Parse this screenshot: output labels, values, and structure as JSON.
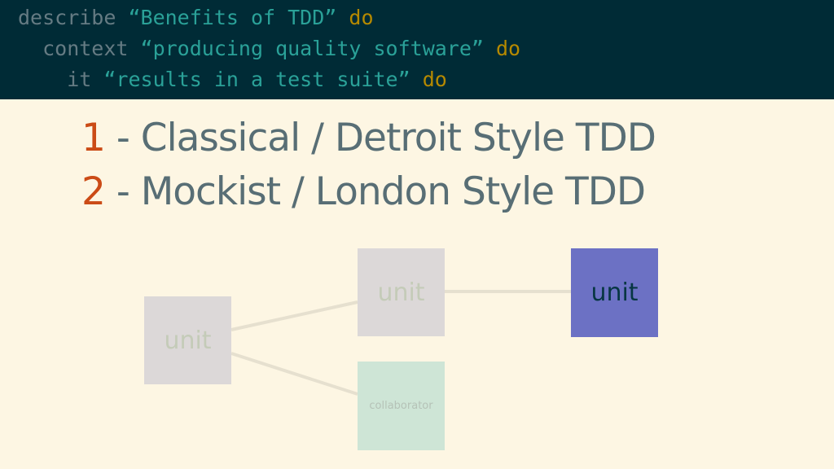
{
  "code": {
    "line1": {
      "keyword": "describe ",
      "string": "“Benefits of TDD”",
      "do": " do"
    },
    "line2": {
      "keyword": "  context ",
      "string": "“producing quality software”",
      "do": " do"
    },
    "line3": {
      "keyword": "    it ",
      "string": "“results in a test suite”",
      "do": " do"
    }
  },
  "headings": [
    {
      "number": "1",
      "text": " - Classical / Detroit Style TDD"
    },
    {
      "number": "2",
      "text": " - Mockist / London Style TDD"
    }
  ],
  "diagram": {
    "nodes": {
      "unit_left": "unit",
      "unit_middle": "unit",
      "collaborator": "collaborator",
      "unit_right": "unit"
    }
  }
}
